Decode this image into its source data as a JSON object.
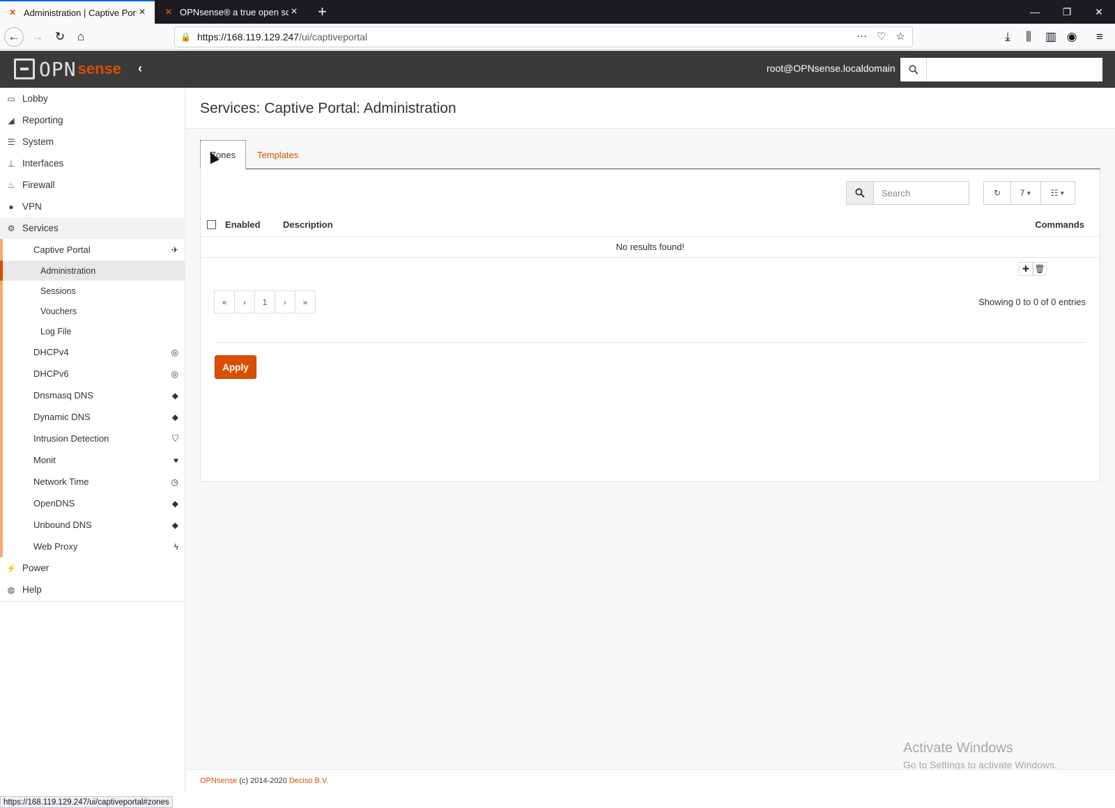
{
  "browser": {
    "tabs": [
      {
        "title": "Administration | Captive Portal",
        "favicon": "opnsense-favicon"
      },
      {
        "title": "OPNsense® a true open source",
        "favicon": "opnsense-favicon"
      }
    ],
    "url_host": "https://168.119.129.247",
    "url_path": "/ui/captiveportal",
    "status_url": "https://168.119.129.247/ui/captiveportal#zones"
  },
  "header": {
    "logo_opn": "OPN",
    "logo_sense": "sense",
    "user": "root@OPNsense.localdomain"
  },
  "sidebar": {
    "top": [
      {
        "label": "Lobby",
        "icon": "laptop-icon"
      },
      {
        "label": "Reporting",
        "icon": "area-chart-icon"
      },
      {
        "label": "System",
        "icon": "server-icon"
      },
      {
        "label": "Interfaces",
        "icon": "sitemap-icon"
      },
      {
        "label": "Firewall",
        "icon": "fire-icon"
      },
      {
        "label": "VPN",
        "icon": "globe-icon"
      },
      {
        "label": "Services",
        "icon": "cog-icon"
      }
    ],
    "services": [
      {
        "label": "Captive Portal",
        "icon": "paper-plane-icon"
      },
      {
        "label": "DHCPv4",
        "icon": "bullseye-icon"
      },
      {
        "label": "DHCPv6",
        "icon": "bullseye-icon"
      },
      {
        "label": "Dnsmasq DNS",
        "icon": "tags-icon"
      },
      {
        "label": "Dynamic DNS",
        "icon": "tags-icon"
      },
      {
        "label": "Intrusion Detection",
        "icon": "shield-icon"
      },
      {
        "label": "Monit",
        "icon": "heartbeat-icon"
      },
      {
        "label": "Network Time",
        "icon": "clock-icon"
      },
      {
        "label": "OpenDNS",
        "icon": "tags-icon"
      },
      {
        "label": "Unbound DNS",
        "icon": "tags-icon"
      },
      {
        "label": "Web Proxy",
        "icon": "bolt-icon"
      }
    ],
    "captive_portal_sub": [
      "Administration",
      "Sessions",
      "Vouchers",
      "Log File"
    ],
    "bottom": [
      {
        "label": "Power",
        "icon": "plug-icon"
      },
      {
        "label": "Help",
        "icon": "life-ring-icon"
      }
    ]
  },
  "page": {
    "title": "Services: Captive Portal: Administration",
    "tabs": [
      "Zones",
      "Templates"
    ],
    "search_placeholder": "Search",
    "rows_per_page": "7",
    "columns": {
      "enabled": "Enabled",
      "description": "Description",
      "commands": "Commands"
    },
    "empty_message": "No results found!",
    "pager": [
      "«",
      "‹",
      "1",
      "›",
      "»"
    ],
    "entries_info": "Showing 0 to 0 of 0 entries",
    "apply_label": "Apply"
  },
  "watermark": {
    "line1": "Activate Windows",
    "line2": "Go to Settings to activate Windows."
  },
  "footer": {
    "brand": "OPNsense",
    "copyright": " (c) 2014-2020 ",
    "company": "Deciso B.V."
  },
  "colors": {
    "accent": "#d94f00",
    "header_bg": "#3a3a3a"
  }
}
